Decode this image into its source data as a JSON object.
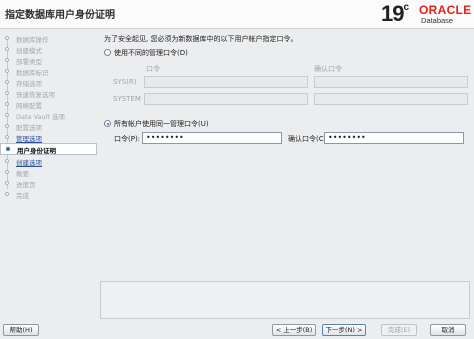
{
  "header": {
    "title": "指定数据库用户身份证明",
    "logo_version": "19",
    "logo_version_sup": "c",
    "logo_brand": "ORACLE",
    "logo_product": "Database"
  },
  "sidebar": {
    "steps": [
      {
        "label": "数据库操作",
        "state": "done"
      },
      {
        "label": "创建模式",
        "state": "done"
      },
      {
        "label": "部署类型",
        "state": "done"
      },
      {
        "label": "数据库标识",
        "state": "done"
      },
      {
        "label": "存储选项",
        "state": "done"
      },
      {
        "label": "快速恢复选项",
        "state": "done"
      },
      {
        "label": "网络配置",
        "state": "done"
      },
      {
        "label": "Data Vault 选项",
        "state": "done"
      },
      {
        "label": "配置选项",
        "state": "done"
      },
      {
        "label": "管理选项",
        "state": "link"
      },
      {
        "label": "用户身份证明",
        "state": "current"
      },
      {
        "label": "创建选项",
        "state": "link"
      },
      {
        "label": "概要",
        "state": "pending"
      },
      {
        "label": "进度页",
        "state": "pending"
      },
      {
        "label": "完成",
        "state": "pending"
      }
    ]
  },
  "main": {
    "intro": "为了安全起见, 您必须为新数据库中的以下用户帐户指定口令。",
    "option_different": "使用不同的管理口令(D)",
    "col_password": "口令",
    "col_confirm": "确认口令",
    "row_sys": "SYS(R)",
    "row_system": "SYSTEM",
    "option_same": "所有帐户使用同一管理口令(U)",
    "password_label": "口令(P):",
    "password_value": "••••••••",
    "confirm_label": "确认口令(C):",
    "confirm_value": "••••••••"
  },
  "footer": {
    "help": "帮助(H)",
    "back": "< 上一步(B)",
    "next": "下一步(N) >",
    "finish": "完成(E)",
    "cancel": "取消"
  }
}
